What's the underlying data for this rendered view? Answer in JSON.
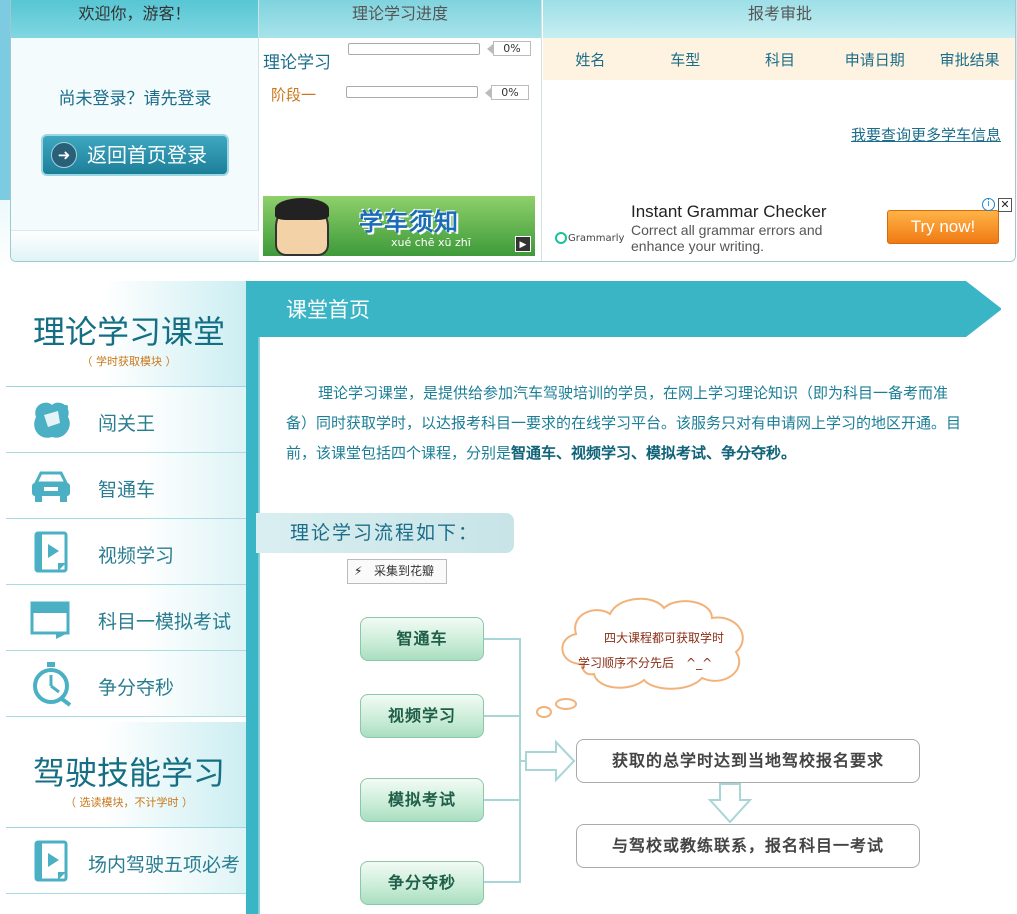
{
  "welcome": {
    "greeting": "欢迎你，游客！",
    "login_hint": "尚未登录？请先登录",
    "login_button": "返回首页登录"
  },
  "progress": {
    "header": "理论学习进度",
    "rows": [
      {
        "label": "理论学习",
        "percent_text": "0%",
        "value": 0
      },
      {
        "label": "阶段一",
        "percent_text": "0%",
        "value": 0
      }
    ],
    "ad": {
      "title": "学车须知",
      "pinyin": "xué chē xū zhī"
    }
  },
  "exam": {
    "header": "报考审批",
    "columns": [
      "姓名",
      "车型",
      "科目",
      "申请日期",
      "审批结果"
    ],
    "more_link": "我要查询更多学车信息",
    "ad": {
      "logo": "Grammarly",
      "title": "Instant Grammar Checker",
      "subtitle": "Correct all grammar errors and enhance your writing.",
      "button": "Try now!"
    }
  },
  "sidebar": {
    "section1": {
      "title": "理论学习课堂",
      "note": "（ 学时获取模块 ）"
    },
    "items": [
      {
        "label": "闯关王",
        "icon": "badge-icon"
      },
      {
        "label": "智通车",
        "icon": "car-icon"
      },
      {
        "label": "视频学习",
        "icon": "video-icon"
      },
      {
        "label": "科目一模拟考试",
        "icon": "exam-icon"
      },
      {
        "label": "争分夺秒",
        "icon": "stopwatch-icon"
      }
    ],
    "section2": {
      "title": "驾驶技能学习",
      "note": "（ 选读模块，不计学时 ）"
    },
    "items2": [
      {
        "label": "场内驾驶五项必考",
        "icon": "video-icon"
      }
    ]
  },
  "main": {
    "banner_title": "课堂首页",
    "intro_text": "理论学习课堂，是提供给参加汽车驾驶培训的学员，在网上学习理论知识（即为科目一备考而准备）同时获取学时，以达报考科目一要求的在线学习平台。该服务只对有申请网上学习的地区开通。目前，该课堂包括四个课程，分别是",
    "intro_bold": "智通车、视频学习、模拟考试、争分夺秒。",
    "flow_label": "理论学习流程如下：",
    "collect_button": "采集到花瓣",
    "flow_items": [
      "智通车",
      "视频学习",
      "模拟考试",
      "争分夺秒"
    ],
    "cloud_line1": "四大课程都可获取学时",
    "cloud_line2": "学习顺序不分先后",
    "cloud_smiley": "^_^",
    "flow_target1": "获取的总学时达到当地驾校报名要求",
    "flow_target2": "与驾校或教练联系，报名科目一考试"
  },
  "colors": {
    "accent": "#3ab5c5",
    "text_link": "#1b6d8a",
    "note_orange": "#c9781b"
  }
}
